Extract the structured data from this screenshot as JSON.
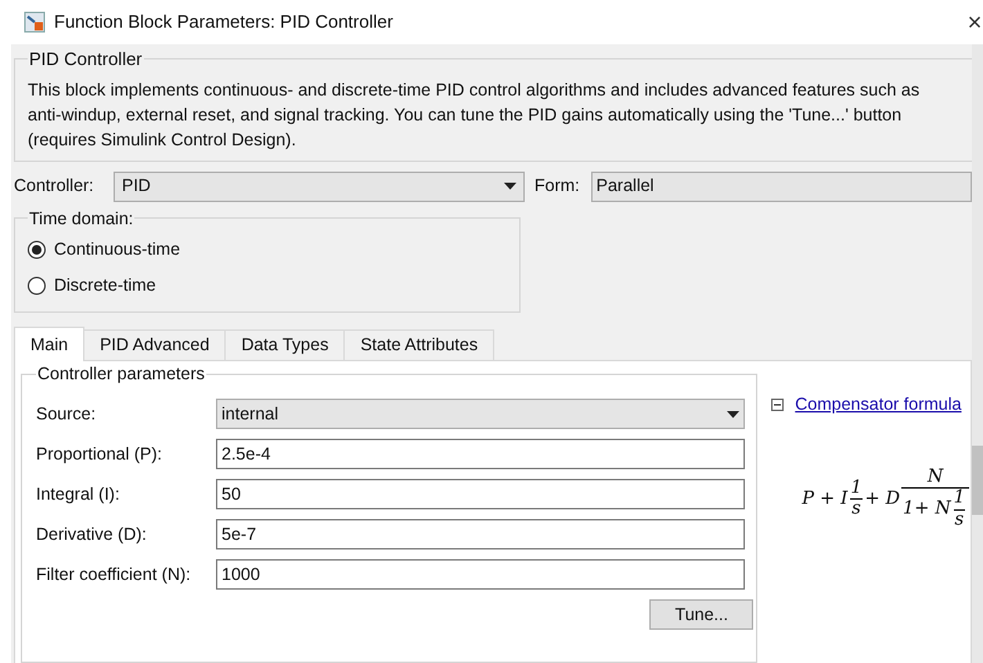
{
  "window": {
    "title": "Function Block Parameters: PID Controller",
    "close": "×"
  },
  "block": {
    "title": "PID Controller",
    "description_lines": [
      "This block implements continuous- and discrete-time PID control algorithms and includes advanced features such as",
      "anti-windup, external reset, and signal tracking. You can tune the PID gains automatically using the 'Tune...' button",
      "(requires Simulink Control Design)."
    ]
  },
  "controller": {
    "label": "Controller:",
    "value": "PID"
  },
  "form": {
    "label": "Form:",
    "value": "Parallel"
  },
  "time_domain": {
    "title": "Time domain:",
    "options": [
      {
        "label": "Continuous-time",
        "selected": true
      },
      {
        "label": "Discrete-time",
        "selected": false
      }
    ]
  },
  "tabs": [
    {
      "label": "Main",
      "selected": true
    },
    {
      "label": "PID Advanced",
      "selected": false
    },
    {
      "label": "Data Types",
      "selected": false
    },
    {
      "label": "State Attributes",
      "selected": false
    }
  ],
  "parameters": {
    "title": "Controller parameters",
    "fields": [
      {
        "kind": "dropdown",
        "label": "Source:",
        "value": "internal"
      },
      {
        "kind": "text",
        "label": "Proportional (P):",
        "value": "2.5e-4"
      },
      {
        "kind": "text",
        "label": "Integral (I):",
        "value": "50"
      },
      {
        "kind": "text",
        "label": "Derivative (D):",
        "value": "5e-7"
      },
      {
        "kind": "text",
        "label": "Filter coefficient (N):",
        "value": "1000"
      }
    ],
    "tune_button": "Tune..."
  },
  "compensator": {
    "expanded": true,
    "link": "Compensator formula",
    "formula": {
      "lead": "P + I",
      "frac1": {
        "num": "1",
        "den": "s"
      },
      "mid": "+ D",
      "frac2": {
        "num": "N",
        "den_lead": "1+ N",
        "den_frac": {
          "num": "1",
          "den": "s"
        }
      }
    }
  }
}
